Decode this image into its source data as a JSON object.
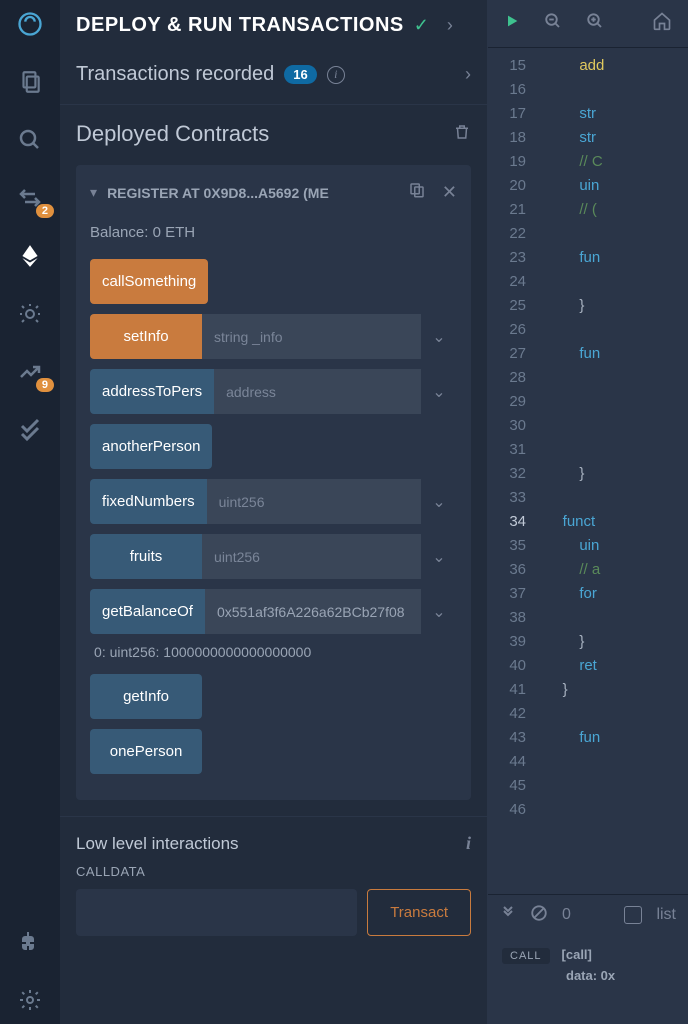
{
  "iconbar": {
    "badges": {
      "swap": "2",
      "chart": "9"
    }
  },
  "header": {
    "title": "DEPLOY & RUN TRANSACTIONS"
  },
  "transactions": {
    "label": "Transactions recorded",
    "count": "16"
  },
  "deployed": {
    "title": "Deployed Contracts",
    "contract": {
      "name": "REGISTER AT 0X9D8...A5692 (ME",
      "balance": "Balance: 0 ETH",
      "functions": [
        {
          "label": "callSomething",
          "type": "orange",
          "input": null
        },
        {
          "label": "setInfo",
          "type": "orange",
          "input": "string _info"
        },
        {
          "label": "addressToPers",
          "type": "blue",
          "input": "address"
        },
        {
          "label": "anotherPerson",
          "type": "blue",
          "input": null
        },
        {
          "label": "fixedNumbers",
          "type": "blue",
          "input": "uint256"
        },
        {
          "label": "fruits",
          "type": "blue",
          "input": "uint256"
        },
        {
          "label": "getBalanceOf",
          "type": "blue",
          "input": "0x551af3f6A226a62BCb27f08"
        },
        {
          "label": "getInfo",
          "type": "blue",
          "input": null
        },
        {
          "label": "onePerson",
          "type": "blue",
          "input": null
        }
      ],
      "result": "0: uint256: 1000000000000000000"
    }
  },
  "lowlevel": {
    "title": "Low level interactions",
    "calldata_label": "CALLDATA",
    "transact_label": "Transact"
  },
  "editor": {
    "lines": [
      15,
      16,
      17,
      18,
      19,
      20,
      21,
      22,
      23,
      24,
      25,
      26,
      27,
      28,
      29,
      30,
      31,
      32,
      33,
      34,
      35,
      36,
      37,
      38,
      39,
      40,
      41,
      42,
      43,
      44,
      45,
      46
    ],
    "highlight_line": 34,
    "code_lines": [
      {
        "indent": 2,
        "tokens": [
          {
            "t": "add",
            "c": "fn"
          }
        ]
      },
      {
        "indent": 0,
        "tokens": []
      },
      {
        "indent": 2,
        "tokens": [
          {
            "t": "str",
            "c": "kw"
          }
        ]
      },
      {
        "indent": 2,
        "tokens": [
          {
            "t": "str",
            "c": "kw"
          }
        ]
      },
      {
        "indent": 2,
        "tokens": [
          {
            "t": "// C",
            "c": "cm"
          }
        ]
      },
      {
        "indent": 2,
        "tokens": [
          {
            "t": "uin",
            "c": "kw"
          }
        ]
      },
      {
        "indent": 2,
        "tokens": [
          {
            "t": "// (",
            "c": "cm"
          }
        ]
      },
      {
        "indent": 0,
        "tokens": []
      },
      {
        "indent": 2,
        "tokens": [
          {
            "t": "fun",
            "c": "kw"
          }
        ]
      },
      {
        "indent": 3,
        "tokens": []
      },
      {
        "indent": 2,
        "tokens": [
          {
            "t": "}",
            "c": ""
          }
        ]
      },
      {
        "indent": 0,
        "tokens": []
      },
      {
        "indent": 2,
        "tokens": [
          {
            "t": "fun",
            "c": "kw"
          }
        ]
      },
      {
        "indent": 3,
        "tokens": []
      },
      {
        "indent": 3,
        "tokens": []
      },
      {
        "indent": 3,
        "tokens": []
      },
      {
        "indent": 3,
        "tokens": []
      },
      {
        "indent": 2,
        "tokens": [
          {
            "t": "}",
            "c": ""
          }
        ]
      },
      {
        "indent": 0,
        "tokens": []
      },
      {
        "indent": 1,
        "tokens": [
          {
            "t": "funct",
            "c": "kw"
          }
        ]
      },
      {
        "indent": 2,
        "tokens": [
          {
            "t": "uin",
            "c": "kw"
          }
        ]
      },
      {
        "indent": 2,
        "tokens": [
          {
            "t": "// a",
            "c": "cm"
          }
        ]
      },
      {
        "indent": 2,
        "tokens": [
          {
            "t": "for",
            "c": "kw"
          }
        ]
      },
      {
        "indent": 3,
        "tokens": []
      },
      {
        "indent": 2,
        "tokens": [
          {
            "t": "}",
            "c": ""
          }
        ]
      },
      {
        "indent": 2,
        "tokens": [
          {
            "t": "ret",
            "c": "kw"
          }
        ]
      },
      {
        "indent": 1,
        "tokens": [
          {
            "t": "}",
            "c": ""
          }
        ]
      },
      {
        "indent": 0,
        "tokens": []
      },
      {
        "indent": 2,
        "tokens": [
          {
            "t": "fun",
            "c": "kw"
          }
        ]
      },
      {
        "indent": 3,
        "tokens": []
      },
      {
        "indent": 3,
        "tokens": []
      },
      {
        "indent": 3,
        "tokens": []
      }
    ]
  },
  "terminal": {
    "zero": "0",
    "list_label": "list",
    "out_tag": "CALL",
    "out_line1": "[call]",
    "out_line2": "data: 0x"
  }
}
